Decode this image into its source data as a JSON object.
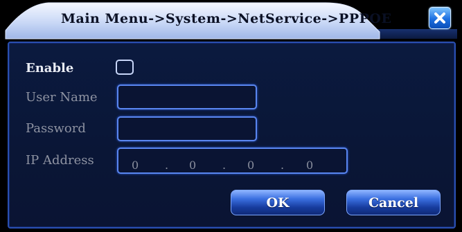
{
  "window": {
    "title": "Main Menu->System->NetService->PPPOE"
  },
  "form": {
    "enable_label": "Enable",
    "enable_checked": false,
    "username_label": "User Name",
    "username_value": "",
    "password_label": "Password",
    "password_value": "",
    "ip_label": "IP Address",
    "ip_octets": [
      "0",
      "0",
      "0",
      "0"
    ],
    "ip_separator": "."
  },
  "buttons": {
    "ok_label": "OK",
    "cancel_label": "Cancel"
  },
  "icons": {
    "close": "close-icon"
  }
}
